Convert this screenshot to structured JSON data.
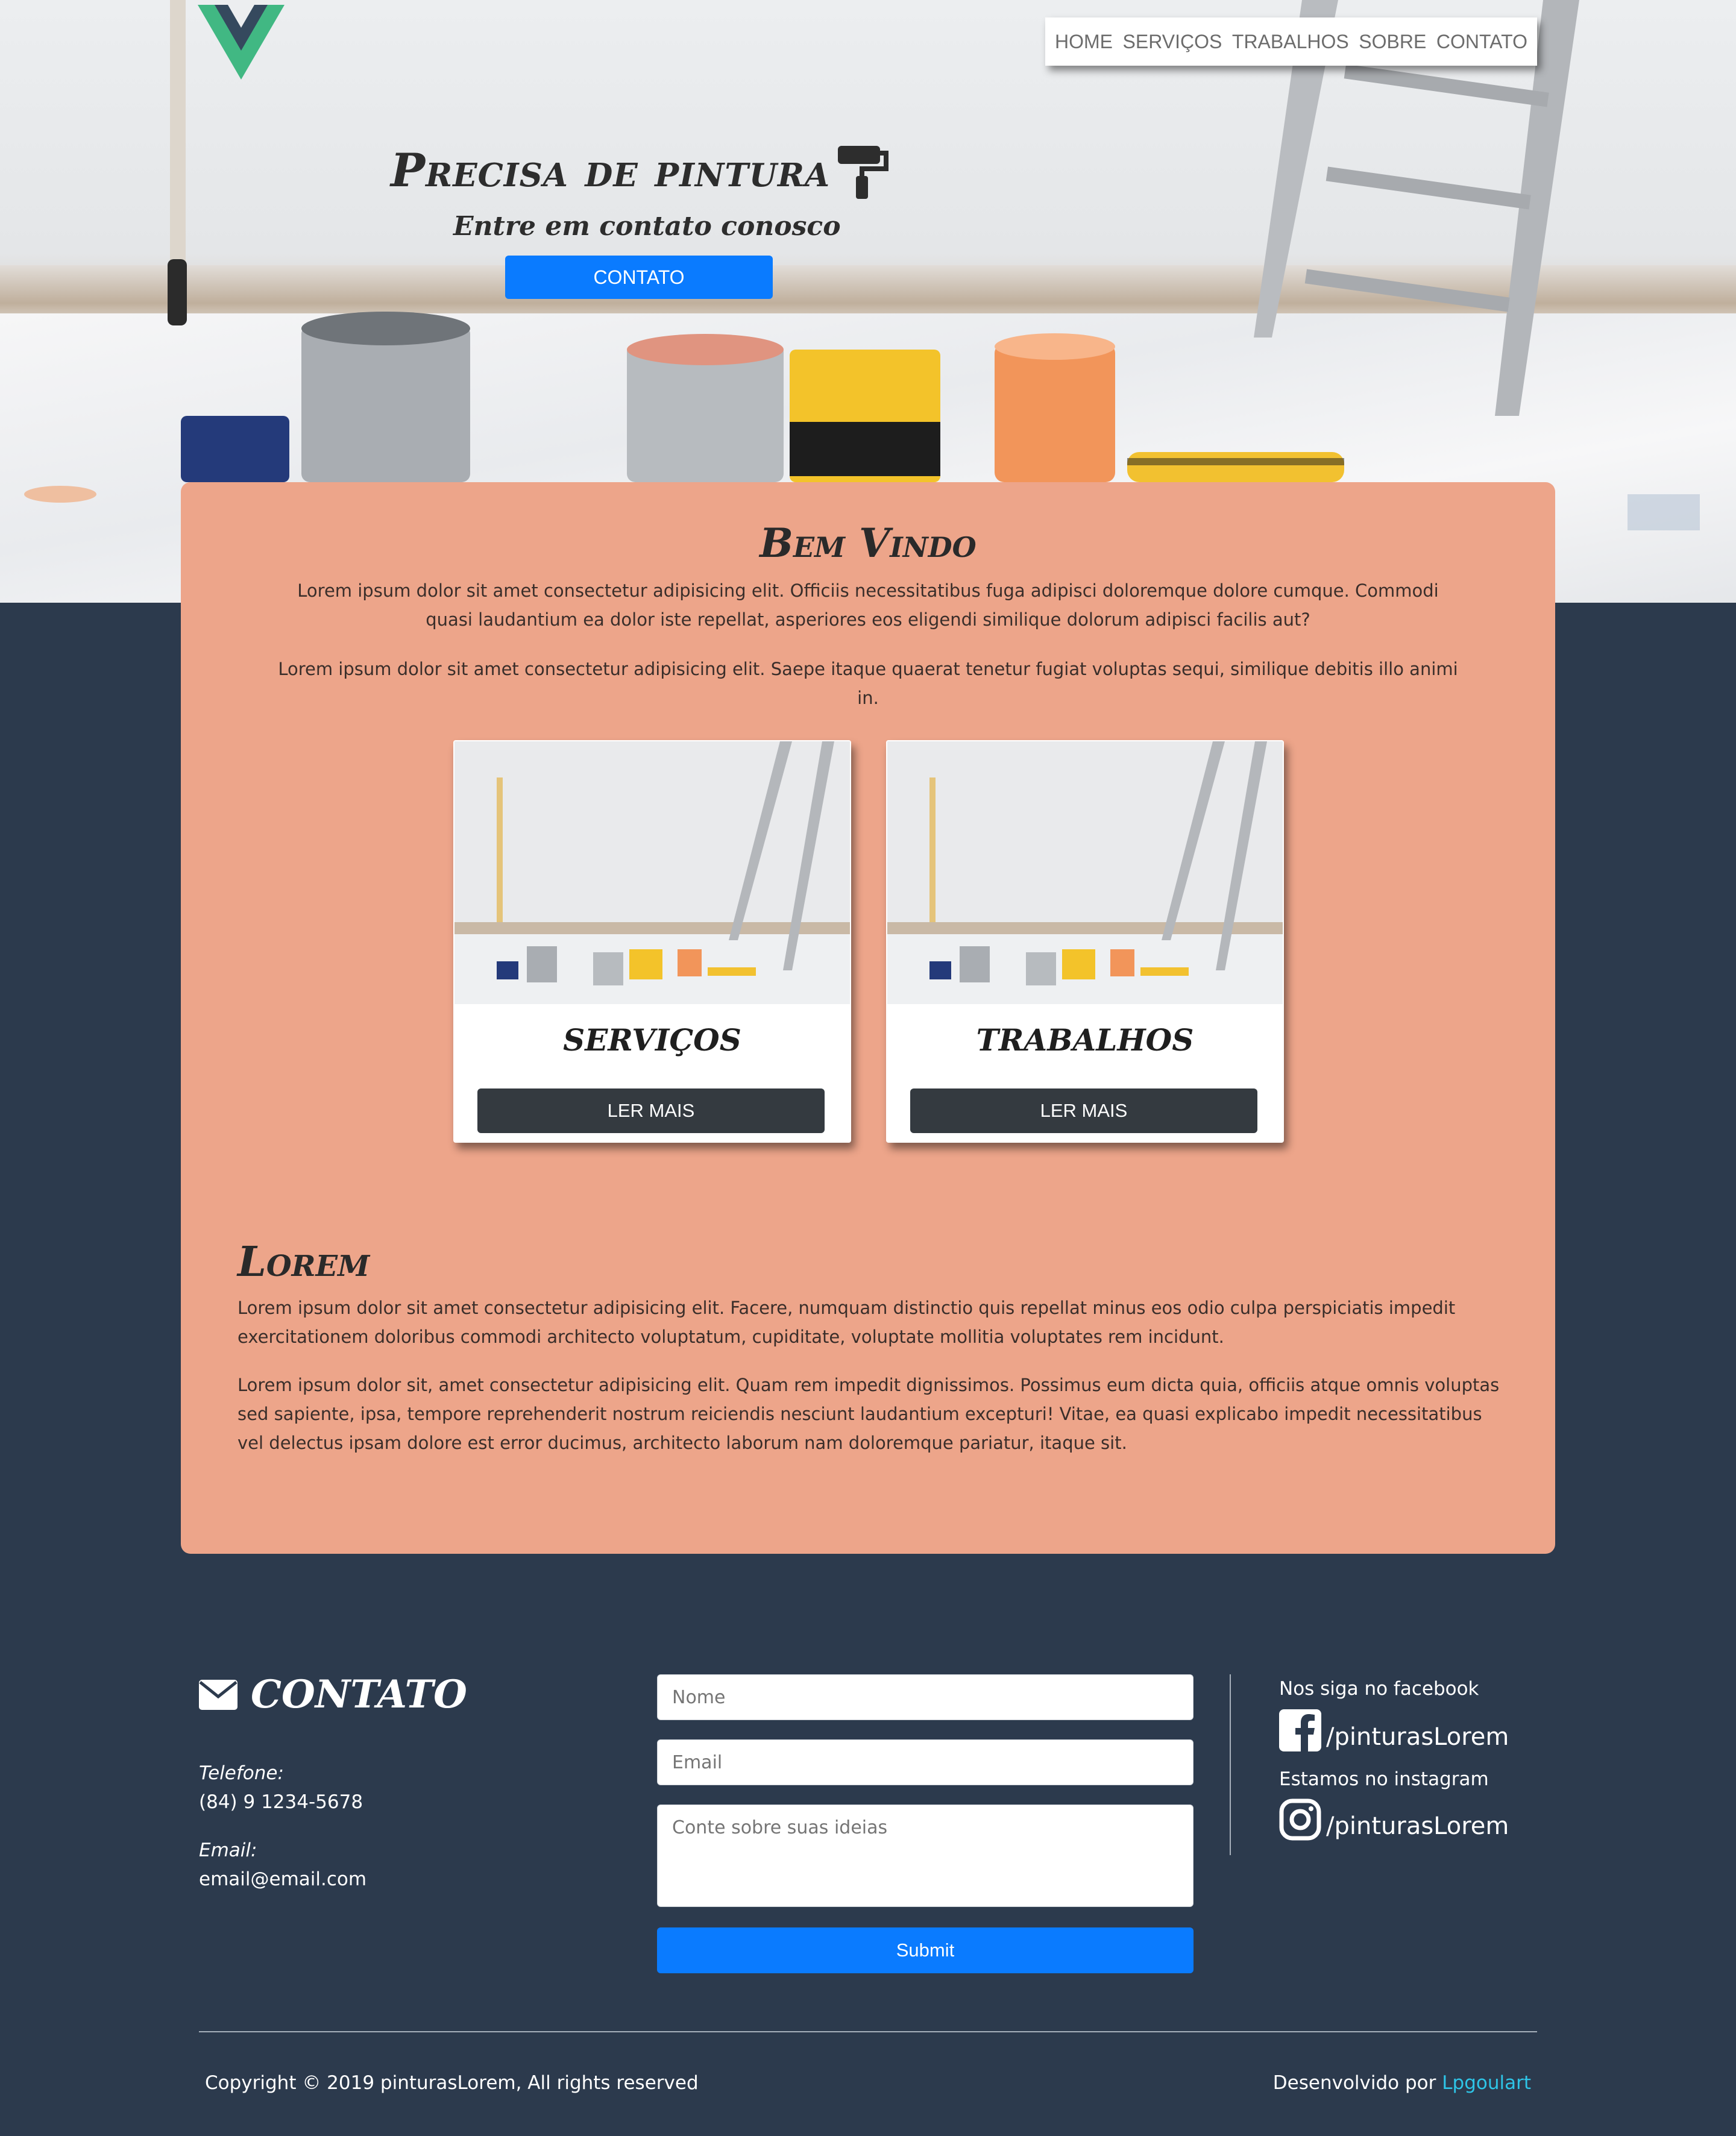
{
  "colors": {
    "page_background": "#2c3a4d",
    "panel": "#eda58a",
    "primary_button": "#0a7bff",
    "dark_button": "#343a40",
    "link": "#2ec4e6",
    "logo_green": "#41b883",
    "logo_dark": "#35495e"
  },
  "brand": {
    "logo_icon": "vue-logo-icon"
  },
  "nav": {
    "items": [
      "HOME",
      "SERVIÇOS",
      "TRABALHOS",
      "SOBRE",
      "CONTATO"
    ]
  },
  "hero": {
    "title": "Precisa de pintura",
    "title_icon": "paint-roller-icon",
    "subtitle": "Entre em contato conosco",
    "button": "CONTATO"
  },
  "welcome": {
    "title": "Bem Vindo",
    "paragraphs": [
      "Lorem ipsum dolor sit amet consectetur adipisicing elit. Officiis necessitatibus fuga adipisci doloremque dolore cumque. Commodi quasi laudantium ea dolor iste repellat, asperiores eos eligendi similique dolorum adipisci facilis aut?",
      "Lorem ipsum dolor sit amet consectetur adipisicing elit. Saepe itaque quaerat tenetur fugiat voluptas sequi, similique debitis illo animi in."
    ]
  },
  "cards": [
    {
      "title": "SERVIÇOS",
      "button": "LER MAIS"
    },
    {
      "title": "TRABALHOS",
      "button": "LER MAIS"
    }
  ],
  "lorem": {
    "title": "Lorem",
    "paragraphs": [
      "Lorem ipsum dolor sit amet consectetur adipisicing elit. Facere, numquam distinctio quis repellat minus eos odio culpa perspiciatis impedit exercitationem doloribus commodi architecto voluptatum, cupiditate, voluptate mollitia voluptates rem incidunt.",
      "Lorem ipsum dolor sit, amet consectetur adipisicing elit. Quam rem impedit dignissimos. Possimus eum dicta quia, officiis atque omnis voluptas sed sapiente, ipsa, tempore reprehenderit nostrum reiciendis nesciunt laudantium excepturi! Vitae, ea quasi explicabo impedit necessitatibus vel delectus ipsam dolore est error ducimus, architecto laborum nam doloremque pariatur, itaque sit."
    ]
  },
  "contact": {
    "title": "CONTATO",
    "title_icon": "envelope-icon",
    "phone_label": "Telefone:",
    "phone": "(84) 9 1234-5678",
    "email_label": "Email:",
    "email": "email@email.com"
  },
  "form": {
    "name_placeholder": "Nome",
    "email_placeholder": "Email",
    "message_placeholder": "Conte sobre suas ideias",
    "submit": "Submit"
  },
  "social": {
    "facebook_label": "Nos siga no facebook",
    "facebook_handle": "/pinturasLorem",
    "facebook_icon": "facebook-icon",
    "instagram_label": "Estamos no instagram",
    "instagram_handle": "/pinturasLorem",
    "instagram_icon": "instagram-icon"
  },
  "footer": {
    "copyright": "Copyright © 2019 pinturasLorem, All rights reserved",
    "developed_by": "Desenvolvido por",
    "developer": "Lpgoulart"
  }
}
